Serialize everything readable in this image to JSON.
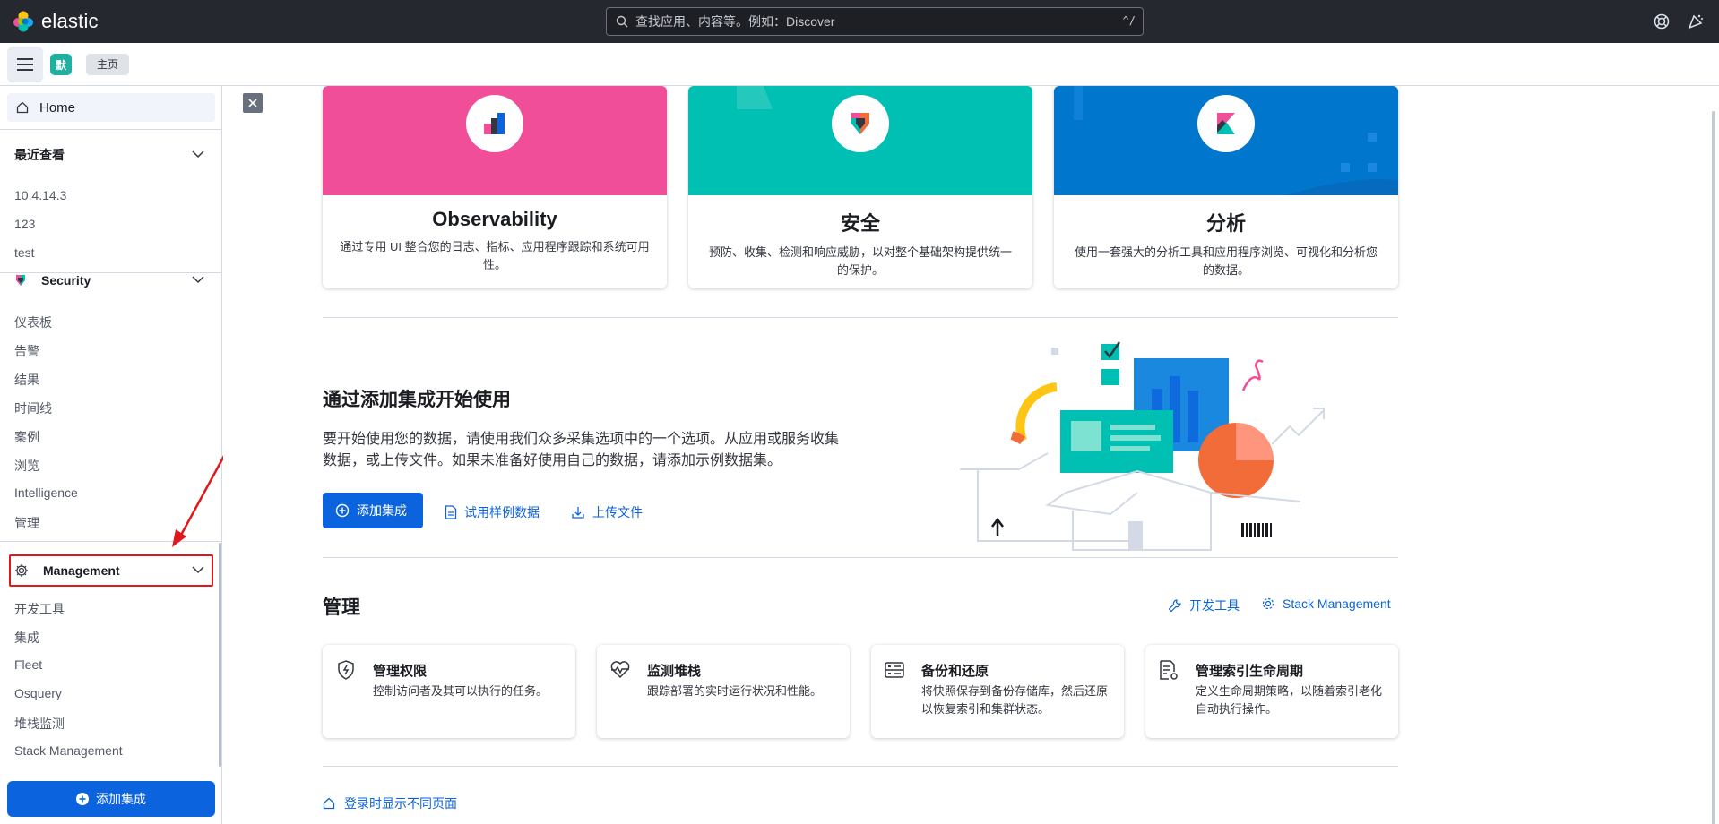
{
  "header": {
    "logo_text": "elastic",
    "search_placeholder": "查找应用、内容等。例如：Discover",
    "search_shortcut": "^/"
  },
  "subbar": {
    "space_initial": "默",
    "breadcrumb": "主页"
  },
  "sidebar": {
    "home_label": "Home",
    "recent": {
      "title": "最近查看",
      "items": [
        "10.4.14.3",
        "123",
        "test"
      ]
    },
    "security": {
      "title": "Security",
      "items": [
        "仪表板",
        "告警",
        "结果",
        "时间线",
        "案例",
        "浏览",
        "Intelligence",
        "管理"
      ]
    },
    "management": {
      "title": "Management",
      "items": [
        "开发工具",
        "集成",
        "Fleet",
        "Osquery",
        "堆栈监测",
        "Stack Management"
      ]
    },
    "add_integration_label": "添加集成"
  },
  "solutions": [
    {
      "title": "Observability",
      "desc": "通过专用 UI 整合您的日志、指标、应用程序跟踪和系统可用性。",
      "color": "#f04e98"
    },
    {
      "title": "安全",
      "desc": "预防、收集、检测和响应威胁，以对整个基础架构提供统一的保护。",
      "color": "#00bfb3"
    },
    {
      "title": "分析",
      "desc": "使用一套强大的分析工具和应用程序浏览、可视化和分析您的数据。",
      "color": "#0077cc"
    }
  ],
  "integrations": {
    "title": "通过添加集成开始使用",
    "desc": "要开始使用您的数据，请使用我们众多采集选项中的一个选项。从应用或服务收集数据，或上传文件。如果未准备好使用自己的数据，请添加示例数据集。",
    "primary_label": "添加集成",
    "sample_label": "试用样例数据",
    "upload_label": "上传文件"
  },
  "management": {
    "title": "管理",
    "dev_tools_label": "开发工具",
    "stack_mgmt_label": "Stack Management",
    "cards": [
      {
        "title": "管理权限",
        "desc": "控制访问者及其可以执行的任务。"
      },
      {
        "title": "监测堆栈",
        "desc": "跟踪部署的实时运行状况和性能。"
      },
      {
        "title": "备份和还原",
        "desc": "将快照保存到备份存储库，然后还原以恢复索引和集群状态。"
      },
      {
        "title": "管理索引生命周期",
        "desc": "定义生命周期策略，以随着索引老化自动执行操作。"
      }
    ]
  },
  "footer": {
    "login_page_label": "登录时显示不同页面"
  }
}
